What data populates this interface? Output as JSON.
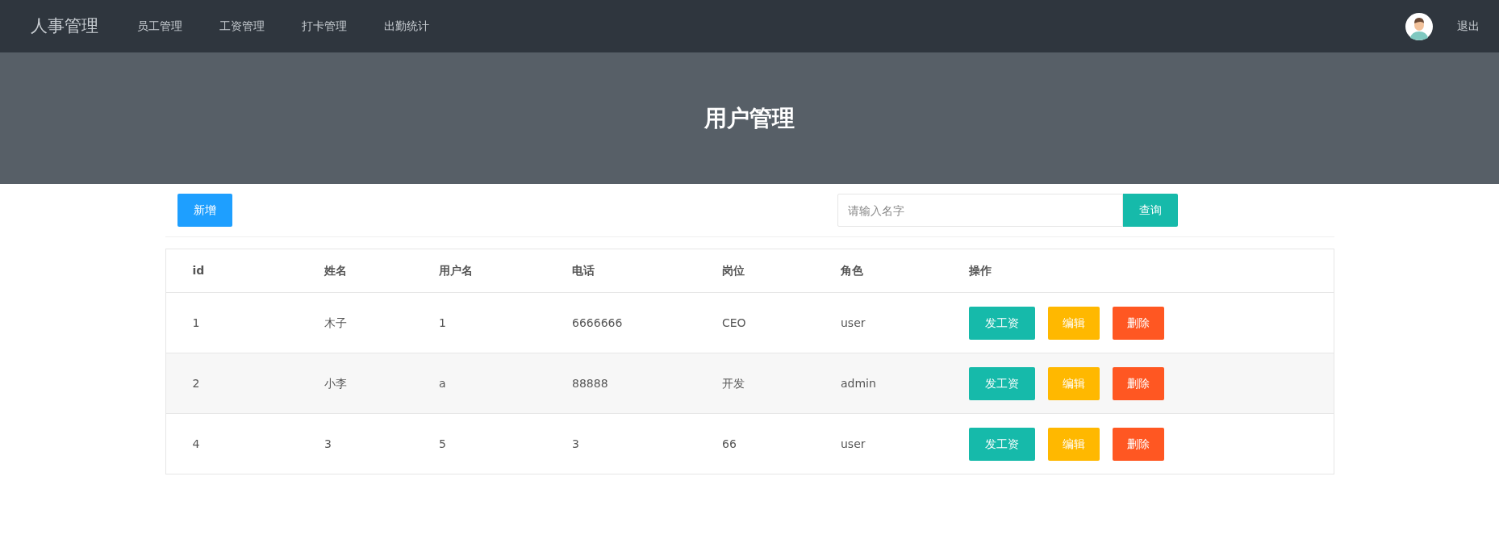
{
  "navbar": {
    "brand": "人事管理",
    "links": [
      "员工管理",
      "工资管理",
      "打卡管理",
      "出勤统计"
    ],
    "logout": "退出"
  },
  "hero": {
    "title": "用户管理"
  },
  "toolbar": {
    "add_button": "新增",
    "search": {
      "placeholder": "请输入名字"
    },
    "search_button": "查询"
  },
  "table": {
    "columns": [
      "id",
      "姓名",
      "用户名",
      "电话",
      "岗位",
      "角色",
      "操作"
    ],
    "rows": [
      {
        "cells": [
          "1",
          "木子",
          "1",
          "6666666",
          "CEO",
          "user"
        ],
        "actions": [
          "发工资",
          "编辑",
          "删除"
        ]
      },
      {
        "cells": [
          "2",
          "小李",
          "a",
          "88888",
          "开发",
          "admin"
        ],
        "actions": [
          "发工资",
          "编辑",
          "删除"
        ]
      },
      {
        "cells": [
          "4",
          "3",
          "5",
          "3",
          "66",
          "user"
        ],
        "actions": [
          "发工资",
          "编辑",
          "删除"
        ]
      }
    ]
  }
}
